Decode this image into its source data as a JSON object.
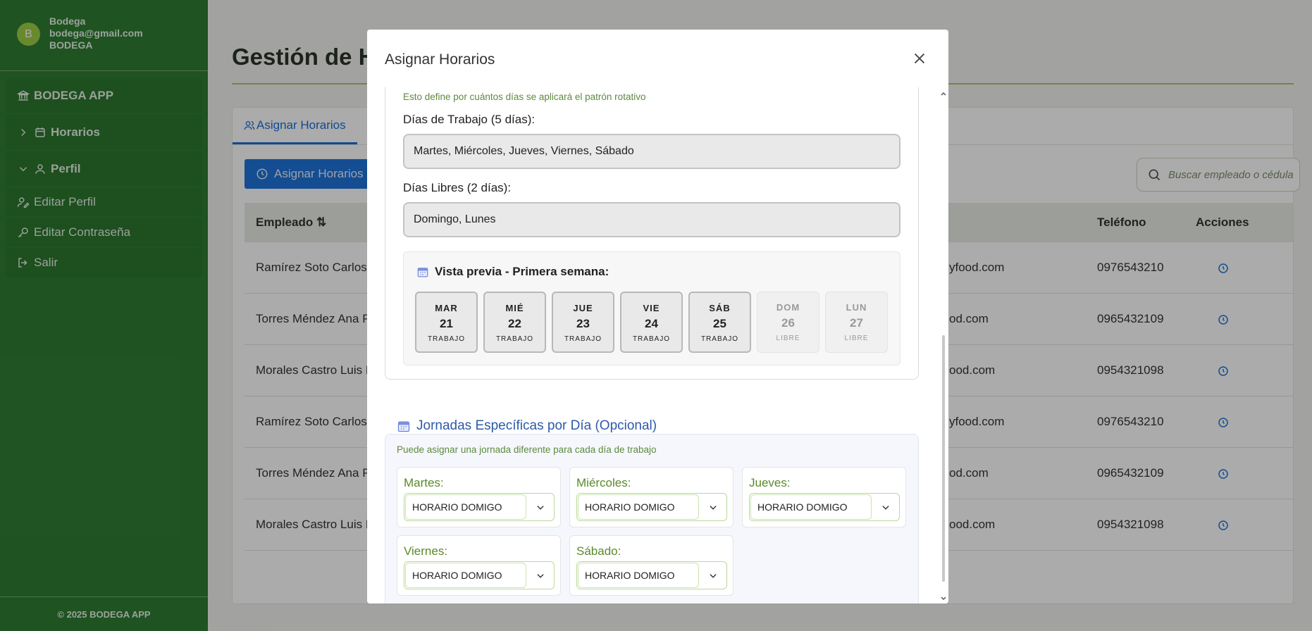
{
  "sidebar": {
    "avatar_letter": "B",
    "user_name": "Bodega",
    "user_email": "bodega@gmail.com",
    "user_role": "BODEGA",
    "app_name": "BODEGA APP",
    "items": [
      {
        "label": "Horarios"
      },
      {
        "label": "Perfil"
      }
    ],
    "subitems": [
      {
        "label": "Editar Perfil"
      },
      {
        "label": "Editar Contraseña"
      },
      {
        "label": "Salir"
      }
    ],
    "footer": "© 2025 BODEGA APP"
  },
  "page": {
    "title": "Gestión de H",
    "tab_label": "Asignar Horarios",
    "button_label": "Asignar Horarios",
    "search_placeholder": "Buscar empleado o cédula"
  },
  "table": {
    "headers": {
      "employee": "Empleado",
      "phone": "Teléfono",
      "actions": "Acciones"
    },
    "rows": [
      {
        "name": "Ramírez Soto Carlos A",
        "email": "yfood.com",
        "phone": "0976543210"
      },
      {
        "name": "Torres Méndez Ana Pa",
        "email": "od.com",
        "phone": "0965432109"
      },
      {
        "name": "Morales Castro Luis Fe",
        "email": "ood.com",
        "phone": "0954321098"
      },
      {
        "name": "Ramírez Soto Carlos A",
        "email": "yfood.com",
        "phone": "0976543210"
      },
      {
        "name": "Torres Méndez Ana Pa",
        "email": "od.com",
        "phone": "0965432109"
      },
      {
        "name": "Morales Castro Luis Fe",
        "email": "ood.com",
        "phone": "0954321098"
      }
    ]
  },
  "modal": {
    "title": "Asignar Horarios",
    "rotation_hint": "Esto define por cuántos días se aplicará el patrón rotativo",
    "work_days_label": "Días de Trabajo (5 días):",
    "work_days_value": "Martes, Miércoles, Jueves, Viernes, Sábado",
    "free_days_label": "Días Libres (2 días):",
    "free_days_value": "Domingo, Lunes",
    "preview_title": "Vista previa - Primera semana:",
    "preview_days": [
      {
        "name": "MAR",
        "num": "21",
        "type": "TRABAJO",
        "work": true
      },
      {
        "name": "MIÉ",
        "num": "22",
        "type": "TRABAJO",
        "work": true
      },
      {
        "name": "JUE",
        "num": "23",
        "type": "TRABAJO",
        "work": true
      },
      {
        "name": "VIE",
        "num": "24",
        "type": "TRABAJO",
        "work": true
      },
      {
        "name": "SÁB",
        "num": "25",
        "type": "TRABAJO",
        "work": true
      },
      {
        "name": "DOM",
        "num": "26",
        "type": "LIBRE",
        "work": false
      },
      {
        "name": "LUN",
        "num": "27",
        "type": "LIBRE",
        "work": false
      }
    ],
    "specific_title": "Jornadas Específicas por Día (Opcional)",
    "specific_hint": "Puede asignar una jornada diferente para cada día de trabajo",
    "day_schedules": [
      {
        "day": "Martes:",
        "value": "HORARIO DOMIGO"
      },
      {
        "day": "Miércoles:",
        "value": "HORARIO DOMIGO"
      },
      {
        "day": "Jueves:",
        "value": "HORARIO DOMIGO"
      },
      {
        "day": "Viernes:",
        "value": "HORARIO DOMIGO"
      },
      {
        "day": "Sábado:",
        "value": "HORARIO DOMIGO"
      }
    ]
  },
  "colors": {
    "sidebar": "#2f7d32",
    "primary": "#1e74d9",
    "accent_green": "#5a8a2a",
    "specific_title": "#2d5aa8"
  }
}
